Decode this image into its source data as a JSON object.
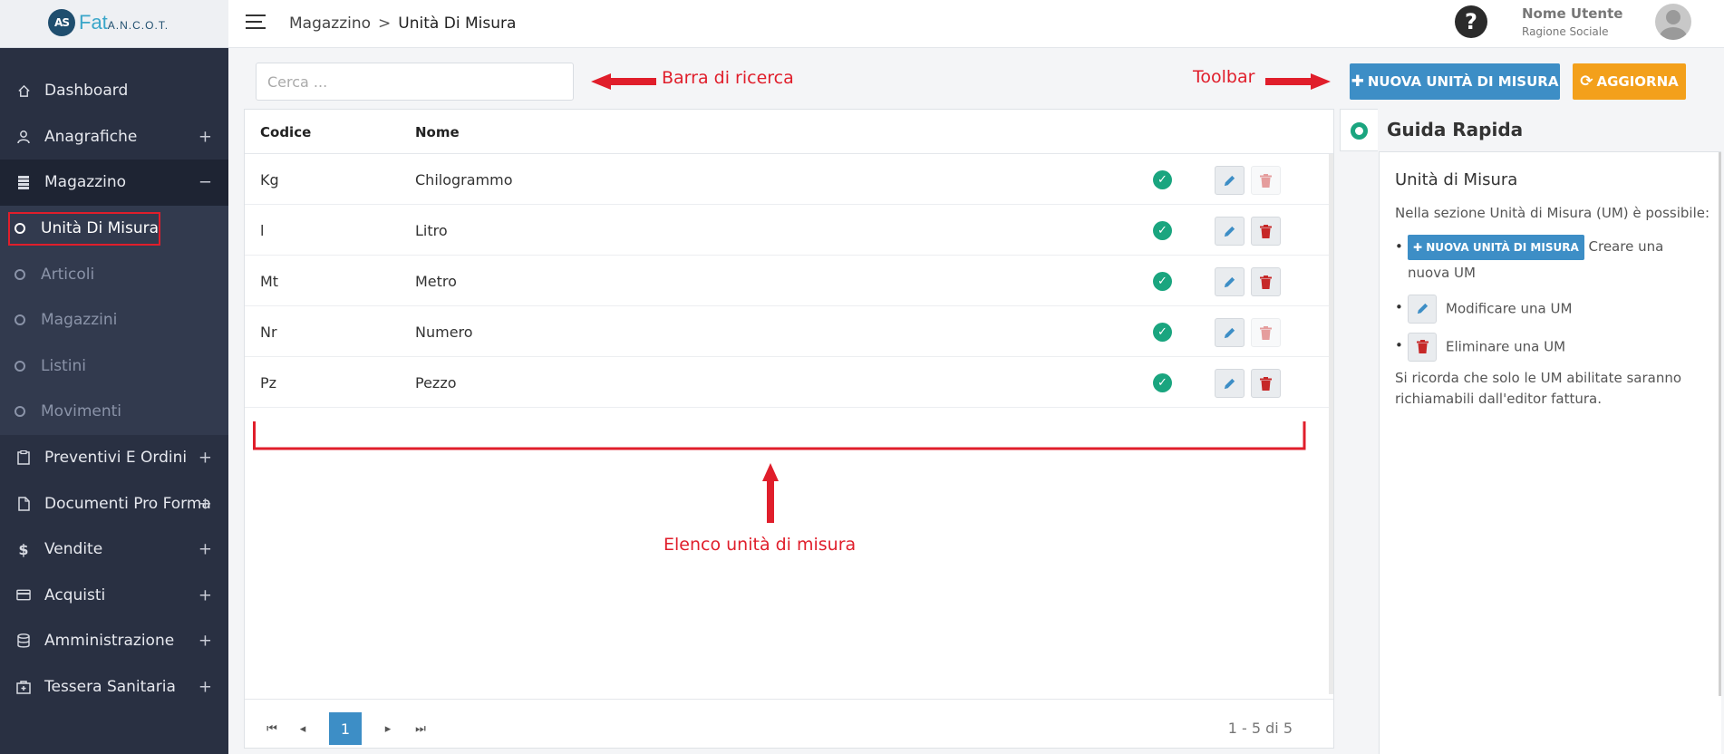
{
  "logo": {
    "mark": "AS",
    "name": "Fat",
    "sub": "A.N.C.O.T."
  },
  "sidebar": {
    "items": [
      {
        "label": "Dashboard",
        "has_toggle": false
      },
      {
        "label": "Anagrafiche",
        "toggle": "+"
      },
      {
        "label": "Magazzino",
        "toggle": "−"
      },
      {
        "label": "Preventivi E Ordini",
        "toggle": "+"
      },
      {
        "label": "Documenti Pro Forma",
        "toggle": "+"
      },
      {
        "label": "Vendite",
        "toggle": "+"
      },
      {
        "label": "Acquisti",
        "toggle": "+"
      },
      {
        "label": "Amministrazione",
        "toggle": "+"
      },
      {
        "label": "Tessera Sanitaria",
        "toggle": "+"
      }
    ],
    "submenu": [
      {
        "label": "Unità Di Misura"
      },
      {
        "label": "Articoli"
      },
      {
        "label": "Magazzini"
      },
      {
        "label": "Listini"
      },
      {
        "label": "Movimenti"
      }
    ]
  },
  "header": {
    "breadcrumb_parent": "Magazzino",
    "breadcrumb_sep": ">",
    "breadcrumb_current": "Unità Di Misura",
    "help": "?",
    "user_name": "Nome Utente",
    "user_company": "Ragione Sociale"
  },
  "search": {
    "placeholder": "Cerca ..."
  },
  "annotations": {
    "search": "Barra di ricerca",
    "toolbar": "Toolbar",
    "list": "Elenco unità di misura"
  },
  "toolbar": {
    "new_label": "NUOVA UNITÀ DI MISURA",
    "refresh_label": "AGGIORNA"
  },
  "table": {
    "headers": [
      "Codice",
      "Nome"
    ],
    "rows": [
      {
        "code": "Kg",
        "name": "Chilogrammo",
        "delete_enabled": false
      },
      {
        "code": "l",
        "name": "Litro",
        "delete_enabled": true
      },
      {
        "code": "Mt",
        "name": "Metro",
        "delete_enabled": true
      },
      {
        "code": "Nr",
        "name": "Numero",
        "delete_enabled": false
      },
      {
        "code": "Pz",
        "name": "Pezzo",
        "delete_enabled": true
      }
    ],
    "page": "1",
    "range": "1 - 5 di 5"
  },
  "guide": {
    "title": "Guida Rapida",
    "heading": "Unità di Misura",
    "intro": "Nella sezione Unità di Misura (UM) è possibile:",
    "new_btn": "NUOVA UNITÀ DI MISURA",
    "item1": "Creare una nuova UM",
    "item2": "Modificare una UM",
    "item3": "Eliminare una UM",
    "note": "Si ricorda che solo le UM abilitate saranno richiamabili dall'editor fattura."
  },
  "colors": {
    "sidebar_bg": "#293042",
    "primary": "#3d8ec6",
    "warning": "#f3a01b",
    "success": "#1aa57f",
    "danger": "#c62828",
    "annotation": "#e01e2b"
  }
}
